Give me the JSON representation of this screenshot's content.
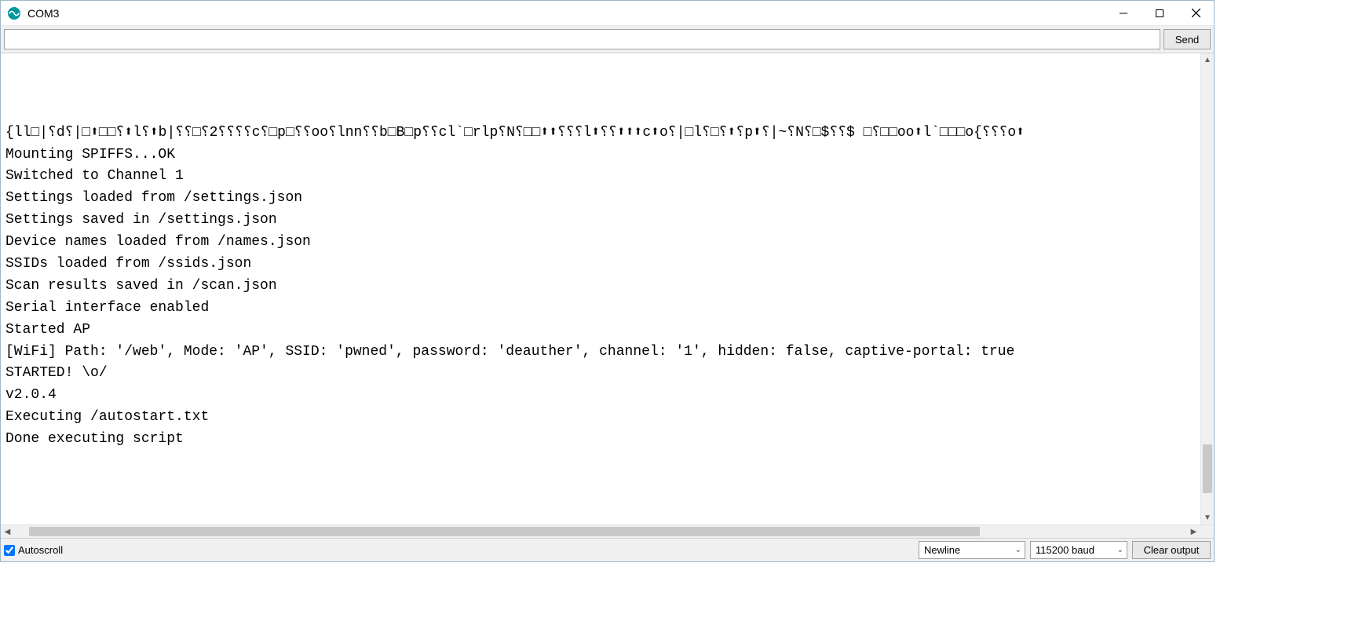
{
  "window": {
    "title": "COM3"
  },
  "input": {
    "value": "",
    "send_label": "Send"
  },
  "output": {
    "lines": "\n\n\n{ll□|⸮d⸮|□⬆□□⸮⬆l⸮⬆b|⸮⸮□⸮2⸮⸮⸮⸮c⸮□p□⸮⸮oo⸮lnn⸮⸮b□B□p⸮⸮cl`□rlp⸮N⸮□□⬆⬆⸮⸮⸮l⬆⸮⸮⬆⬆⬆c⬆o⸮|□l⸮□⸮⬆⸮p⬆⸮|~⸮N⸮□$⸮⸮$ □⸮□□oo⬆l`□□□o{⸮⸮⸮o⬆\nMounting SPIFFS...OK\nSwitched to Channel 1\nSettings loaded from /settings.json\nSettings saved in /settings.json\nDevice names loaded from /names.json\nSSIDs loaded from /ssids.json\nScan results saved in /scan.json\nSerial interface enabled\nStarted AP\n[WiFi] Path: '/web', Mode: 'AP', SSID: 'pwned', password: 'deauther', channel: '1', hidden: false, captive-portal: true\nSTARTED! \\o/\nv2.0.4\nExecuting /autostart.txt\nDone executing script\n"
  },
  "bottom": {
    "autoscroll_label": "Autoscroll",
    "autoscroll_checked": true,
    "line_ending": "Newline",
    "baud": "115200 baud",
    "clear_label": "Clear output"
  }
}
